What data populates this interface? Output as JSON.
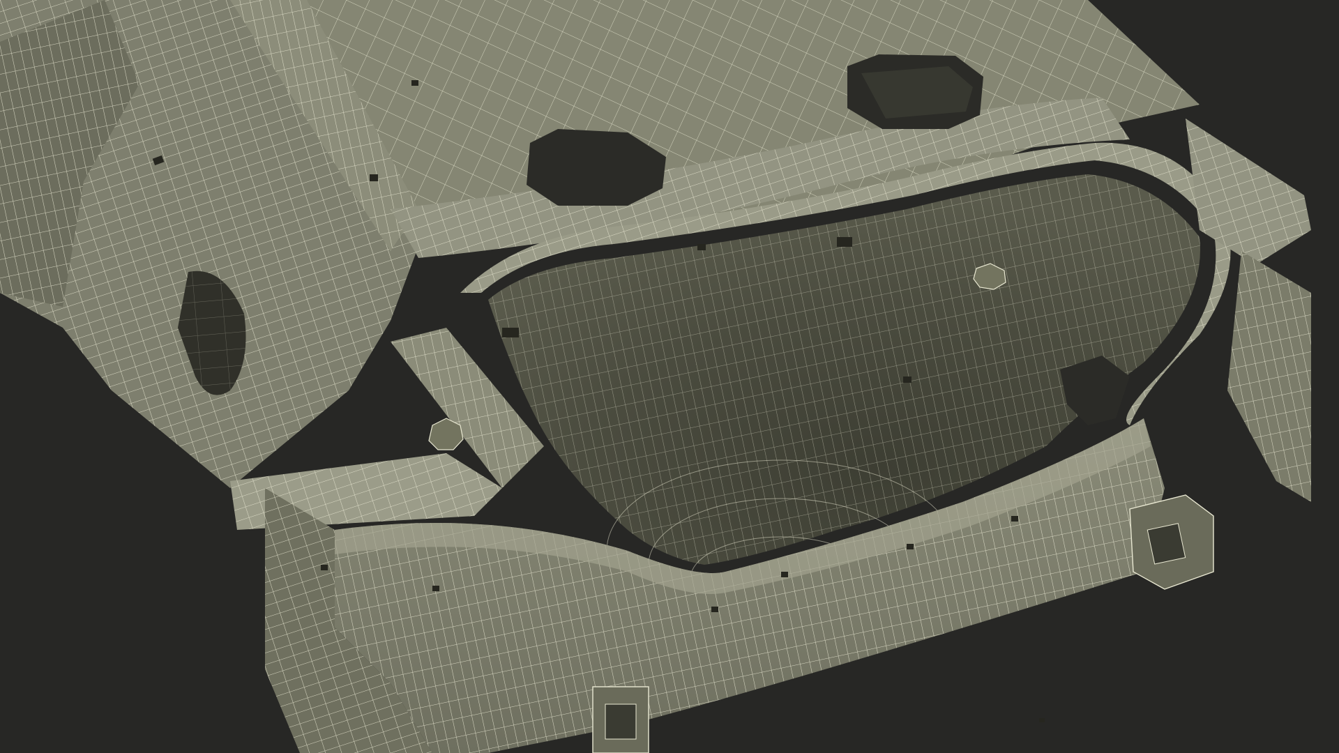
{
  "scene": {
    "subject": "car-body-rear-frame-wireframe",
    "colors": {
      "background": "#272725",
      "surface": "#7f806f",
      "surface_light": "#969784",
      "surface_dark": "#5f604f",
      "cavity": "#4d4e41",
      "cavity_deep": "#3a3b31",
      "hole": "#2b2b27",
      "wire": "#e9e8d2"
    }
  }
}
